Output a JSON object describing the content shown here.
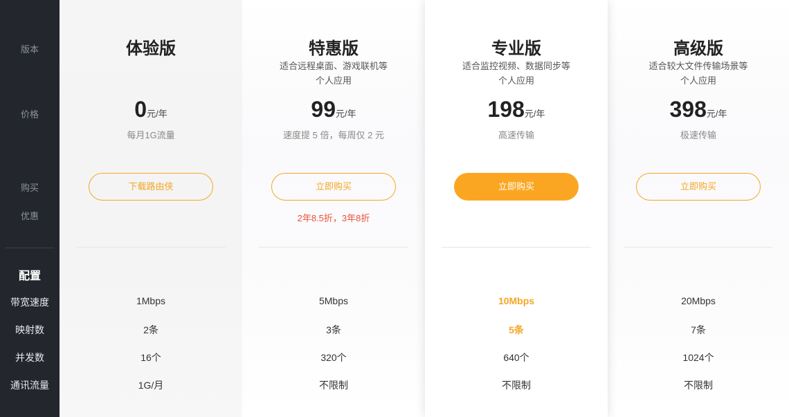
{
  "sidebar": {
    "items": [
      "版本",
      "价格",
      "购买",
      "优惠"
    ],
    "config_heading": "配置",
    "rows": [
      "带宽速度",
      "映射数",
      "并发数",
      "通讯流量"
    ]
  },
  "plans": [
    {
      "name": "体验版",
      "desc": [
        "",
        ""
      ],
      "price": "0",
      "unit": "元/年",
      "sub": "每月1G流量",
      "button": "下载路由侠",
      "promo": "",
      "specs": [
        "1Mbps",
        "2条",
        "16个",
        "1G/月"
      ]
    },
    {
      "name": "特惠版",
      "desc": [
        "适合远程桌面、游戏联机等",
        "个人应用"
      ],
      "price": "99",
      "unit": "元/年",
      "sub": "速度提 5 倍，每周仅 2 元",
      "button": "立即购买",
      "promo": "2年8.5折，3年8折",
      "specs": [
        "5Mbps",
        "3条",
        "320个",
        "不限制"
      ]
    },
    {
      "name": "专业版",
      "desc": [
        "适合监控视频、数据同步等",
        "个人应用"
      ],
      "price": "198",
      "unit": "元/年",
      "sub": "高速传输",
      "button": "立即购买",
      "promo": "",
      "specs": [
        "10Mbps",
        "5条",
        "640个",
        "不限制"
      ]
    },
    {
      "name": "高级版",
      "desc": [
        "适合较大文件传输场景等",
        "个人应用"
      ],
      "price": "398",
      "unit": "元/年",
      "sub": "极速传输",
      "button": "立即购买",
      "promo": "",
      "specs": [
        "20Mbps",
        "7条",
        "1024个",
        "不限制"
      ]
    }
  ],
  "colors": {
    "accent": "#f5a623",
    "promo": "#e8523a",
    "sidebar_bg": "#23272d"
  }
}
